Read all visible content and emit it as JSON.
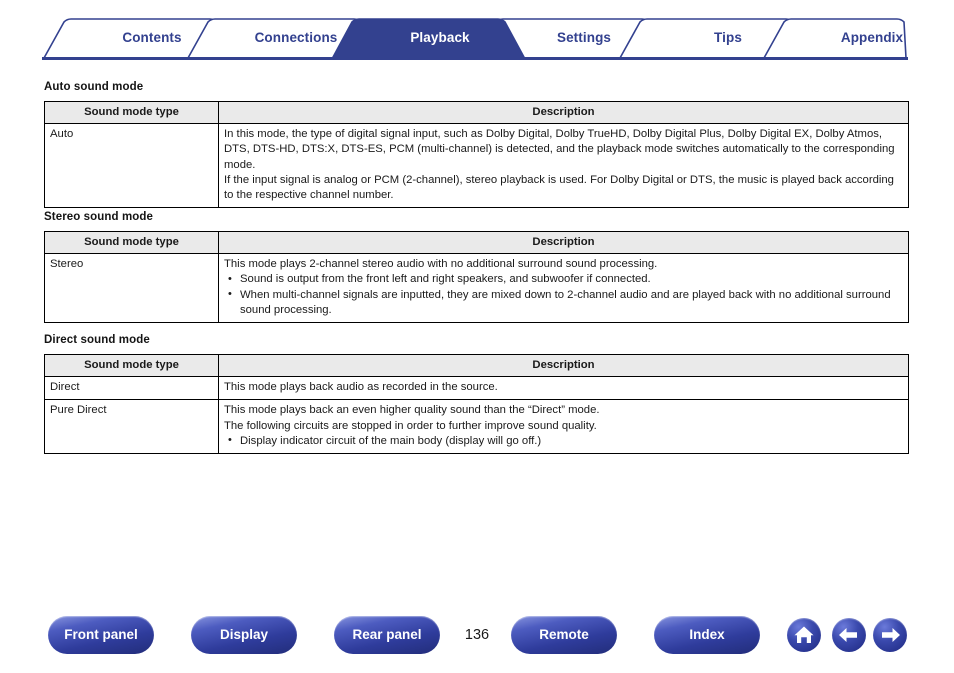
{
  "nav_tabs": [
    {
      "label": "Contents",
      "active": false
    },
    {
      "label": "Connections",
      "active": false
    },
    {
      "label": "Playback",
      "active": true
    },
    {
      "label": "Settings",
      "active": false
    },
    {
      "label": "Tips",
      "active": false
    },
    {
      "label": "Appendix",
      "active": false
    }
  ],
  "sections": [
    {
      "heading": "Auto sound mode",
      "columns": [
        "Sound mode type",
        "Description"
      ],
      "rows": [
        {
          "type": "Auto",
          "lines": [
            "In this mode, the type of digital signal input, such as Dolby Digital, Dolby TrueHD, Dolby Digital Plus, Dolby Digital EX, Dolby Atmos, DTS, DTS-HD, DTS:X, DTS-ES, PCM (multi-channel) is detected, and the playback mode switches automatically to the corresponding mode.",
            "If the input signal is analog or PCM (2-channel), stereo playback is used. For Dolby Digital or DTS, the music is played back according to the respective channel number."
          ],
          "bullets": []
        }
      ]
    },
    {
      "heading": "Stereo sound mode",
      "columns": [
        "Sound mode type",
        "Description"
      ],
      "rows": [
        {
          "type": "Stereo",
          "lines": [
            "This mode plays 2-channel stereo audio with no additional surround sound processing."
          ],
          "bullets": [
            "Sound is output from the front left and right speakers, and subwoofer if connected.",
            "When multi-channel signals are inputted, they are mixed down to 2-channel audio and are played back with no additional surround sound processing."
          ]
        }
      ]
    },
    {
      "heading": "Direct sound mode",
      "columns": [
        "Sound mode type",
        "Description"
      ],
      "rows": [
        {
          "type": "Direct",
          "lines": [
            "This mode plays back audio as recorded in the source."
          ],
          "bullets": []
        },
        {
          "type": "Pure Direct",
          "lines": [
            "This mode plays back an even higher quality sound than the “Direct” mode.",
            "The following circuits are stopped in order to further improve sound quality."
          ],
          "bullets": [
            "Display indicator circuit of the main body (display will go off.)"
          ]
        }
      ]
    }
  ],
  "footer": {
    "buttons": [
      {
        "label": "Front panel"
      },
      {
        "label": "Display"
      },
      {
        "label": "Rear panel"
      },
      {
        "label": "Remote"
      },
      {
        "label": "Index"
      }
    ],
    "page_number": "136",
    "icons": [
      {
        "name": "home-icon"
      },
      {
        "name": "arrow-left-icon"
      },
      {
        "name": "arrow-right-icon"
      }
    ]
  },
  "colors": {
    "brand_blue": "#33418f",
    "active_tab_bg": "#33418f",
    "table_header_bg": "#eaeaea",
    "table_border": "#000000"
  }
}
